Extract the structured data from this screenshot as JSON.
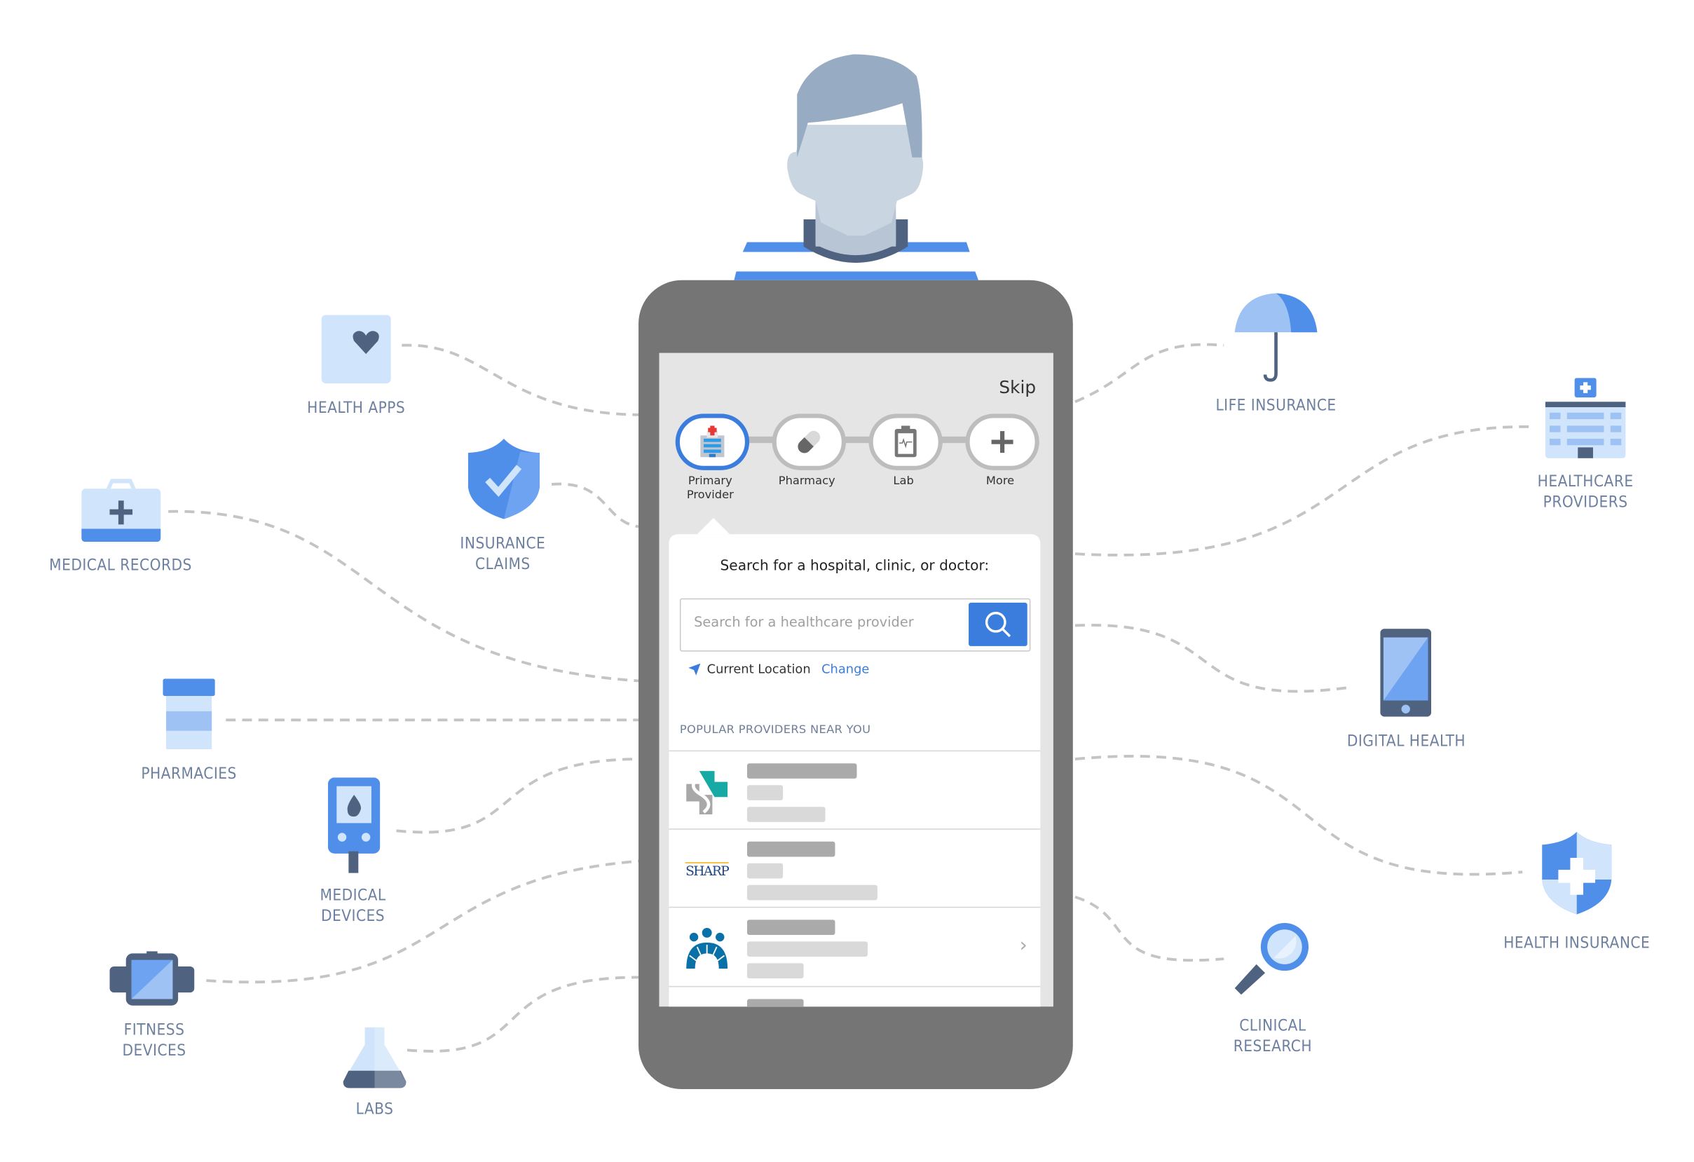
{
  "colors": {
    "accent": "#3b7ddd",
    "label": "#6d80a0",
    "phone": "#757575",
    "light_blue": "#d0e5fb",
    "mid_blue": "#4f8fea",
    "dark_slate": "#4f6280"
  },
  "person": {
    "icon": "person-avatar-icon"
  },
  "nodes": [
    {
      "id": "health-apps",
      "label": "HEALTH APPS",
      "icon": "heart-card-icon"
    },
    {
      "id": "medical-records",
      "label": "MEDICAL RECORDS",
      "icon": "medical-kit-icon"
    },
    {
      "id": "insurance-claims",
      "label": "INSURANCE\nCLAIMS",
      "icon": "shield-check-icon"
    },
    {
      "id": "pharmacies",
      "label": "PHARMACIES",
      "icon": "pill-bottle-icon"
    },
    {
      "id": "medical-devices",
      "label": "MEDICAL\nDEVICES",
      "icon": "glucose-meter-icon"
    },
    {
      "id": "fitness-devices",
      "label": "FITNESS\nDEVICES",
      "icon": "smartwatch-icon"
    },
    {
      "id": "labs",
      "label": "LABS",
      "icon": "flask-icon"
    },
    {
      "id": "life-insurance",
      "label": "LIFE INSURANCE",
      "icon": "umbrella-icon"
    },
    {
      "id": "healthcare-providers",
      "label": "HEALTHCARE\nPROVIDERS",
      "icon": "hospital-icon"
    },
    {
      "id": "digital-health",
      "label": "DIGITAL HEALTH",
      "icon": "tablet-icon"
    },
    {
      "id": "health-insurance",
      "label": "HEALTH INSURANCE",
      "icon": "shield-cross-icon"
    },
    {
      "id": "clinical-research",
      "label": "CLINICAL\nRESEARCH",
      "icon": "magnifier-icon"
    }
  ],
  "app": {
    "skip": "Skip",
    "steps": [
      {
        "label": "Primary\nProvider",
        "icon": "hospital-icon",
        "active": true
      },
      {
        "label": "Pharmacy",
        "icon": "pill-icon",
        "active": false
      },
      {
        "label": "Lab",
        "icon": "clipboard-icon",
        "active": false
      },
      {
        "label": "More",
        "icon": "plus-icon",
        "active": false
      }
    ],
    "search_heading": "Search for a hospital, clinic, or doctor:",
    "search_placeholder": "Search for a healthcare provider",
    "search_value": "",
    "location_label": "Current Location",
    "change_link": "Change",
    "popular_heading": "POPULAR PROVIDERS NEAR YOU",
    "providers": [
      {
        "logo": "cross-s-logo"
      },
      {
        "logo": "sharp-logo",
        "logo_text": "SHARP"
      },
      {
        "logo": "kaiser-logo"
      },
      {
        "logo": ""
      }
    ]
  }
}
